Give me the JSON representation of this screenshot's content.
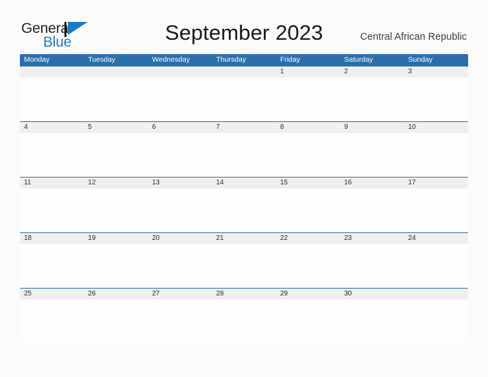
{
  "brand": {
    "name_part1": "General",
    "name_part2": "Blue",
    "flag_icon": "blue-triangle-flag-icon",
    "color_dark": "#222222",
    "color_blue": "#1f7ac4"
  },
  "header": {
    "title": "September 2023",
    "region": "Central African Republic"
  },
  "calendar": {
    "month": "September",
    "year": "2023",
    "accent_color": "#2c6ead",
    "band_color": "#efefef",
    "weekdays": [
      "Monday",
      "Tuesday",
      "Wednesday",
      "Thursday",
      "Friday",
      "Saturday",
      "Sunday"
    ],
    "weeks": [
      [
        "",
        "",
        "",
        "",
        "1",
        "2",
        "3"
      ],
      [
        "4",
        "5",
        "6",
        "7",
        "8",
        "9",
        "10"
      ],
      [
        "11",
        "12",
        "13",
        "14",
        "15",
        "16",
        "17"
      ],
      [
        "18",
        "19",
        "20",
        "21",
        "22",
        "23",
        "24"
      ],
      [
        "25",
        "26",
        "27",
        "28",
        "29",
        "30",
        ""
      ]
    ]
  }
}
